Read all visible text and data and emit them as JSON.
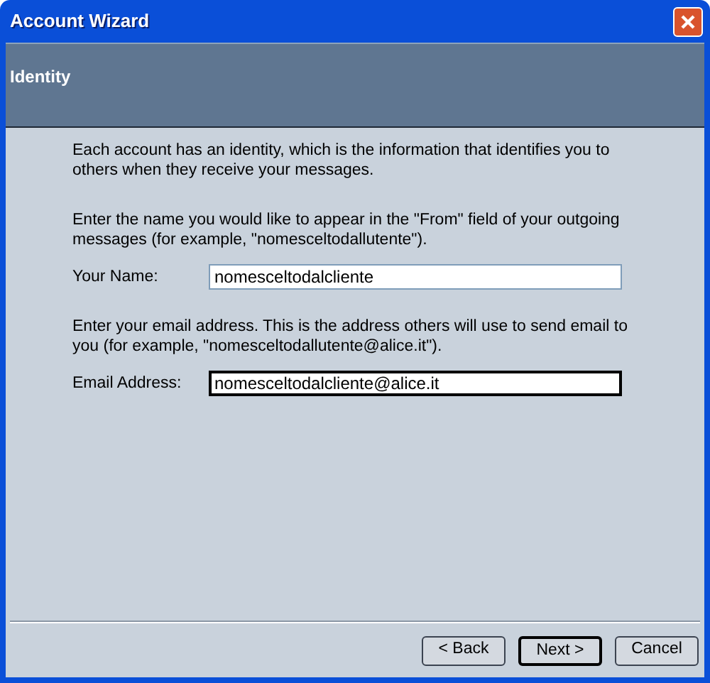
{
  "window": {
    "title": "Account Wizard"
  },
  "header": {
    "title": "Identity"
  },
  "intro": "Each account has an identity, which is the information that identifies you to others when they receive your messages.",
  "sections": [
    {
      "text": "Enter the name you would like to appear in the \"From\" field of your outgoing messages (for example, \"nomesceltodallutente\").",
      "label": "Your Name:",
      "value": "nomesceltodalcliente",
      "focused": false
    },
    {
      "text": "Enter your email address. This is the address others will use to send email to you (for example, \"nomesceltodallutente@alice.it\").",
      "label": "Email Address:",
      "value": "nomesceltodalcliente@alice.it",
      "focused": true
    }
  ],
  "buttons": [
    {
      "label": "< Back",
      "default": false
    },
    {
      "label": "Next >",
      "default": true
    },
    {
      "label": "Cancel",
      "default": false
    }
  ]
}
